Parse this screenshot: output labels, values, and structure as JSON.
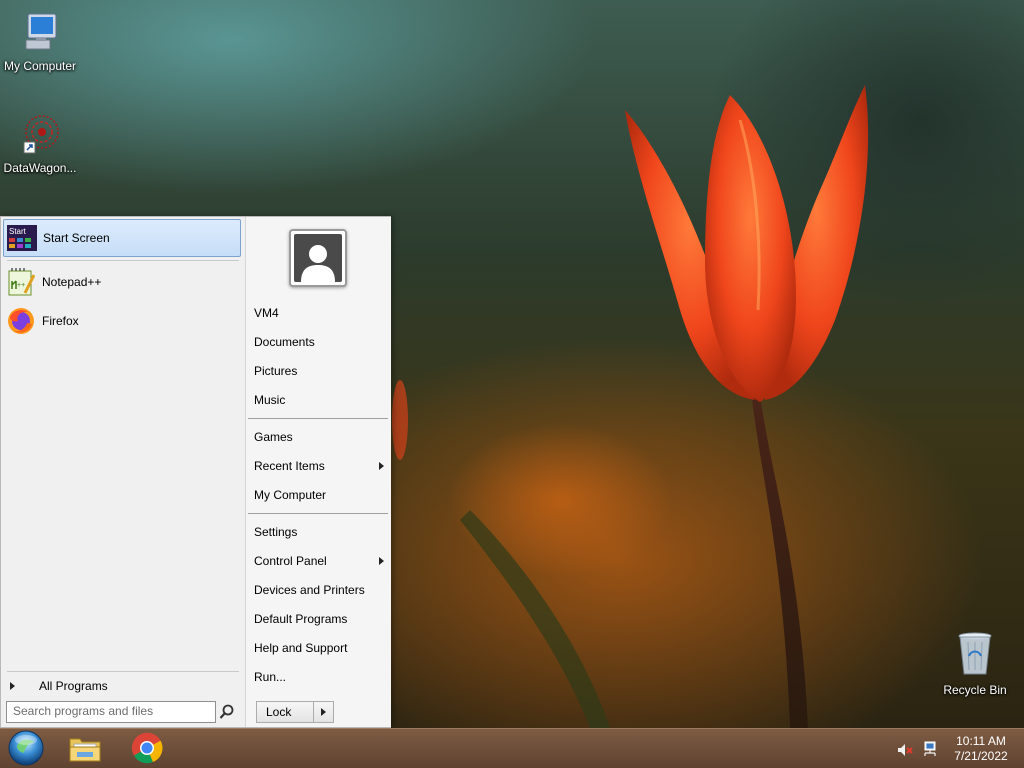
{
  "desktop": {
    "icons": [
      {
        "label": "My Computer",
        "icon": "computer-icon"
      },
      {
        "label": "DataWagon...",
        "icon": "datawagon-icon"
      },
      {
        "label": "Recycle Bin",
        "icon": "recycle-bin-icon"
      }
    ]
  },
  "start_menu": {
    "programs": [
      {
        "label": "Start Screen",
        "icon": "start-screen-icon",
        "selected": true
      },
      {
        "label": "Notepad++",
        "icon": "notepad-plus-plus-icon"
      },
      {
        "label": "Firefox",
        "icon": "firefox-icon"
      }
    ],
    "all_programs_label": "All Programs",
    "search_placeholder": "Search programs and files",
    "right_items": [
      {
        "label": "VM4"
      },
      {
        "label": "Documents"
      },
      {
        "label": "Pictures"
      },
      {
        "label": "Music"
      },
      {
        "label": "Games"
      },
      {
        "label": "Recent Items",
        "submenu": true
      },
      {
        "label": "My Computer"
      },
      {
        "label": "Settings"
      },
      {
        "label": "Control Panel",
        "submenu": true
      },
      {
        "label": "Devices and Printers"
      },
      {
        "label": "Default Programs"
      },
      {
        "label": "Help and Support"
      },
      {
        "label": "Run..."
      }
    ],
    "lock_label": "Lock"
  },
  "taskbar": {
    "pinned": [
      "start-orb-icon",
      "file-explorer-icon",
      "chrome-icon"
    ],
    "tray_icons": [
      "volume-muted-icon",
      "network-icon"
    ],
    "clock": {
      "time": "10:11 AM",
      "date": "7/21/2022"
    }
  },
  "colors": {
    "taskbar": "#6b4b37",
    "selected_item": "#cfe3fa",
    "selected_border": "#7da2ce"
  }
}
